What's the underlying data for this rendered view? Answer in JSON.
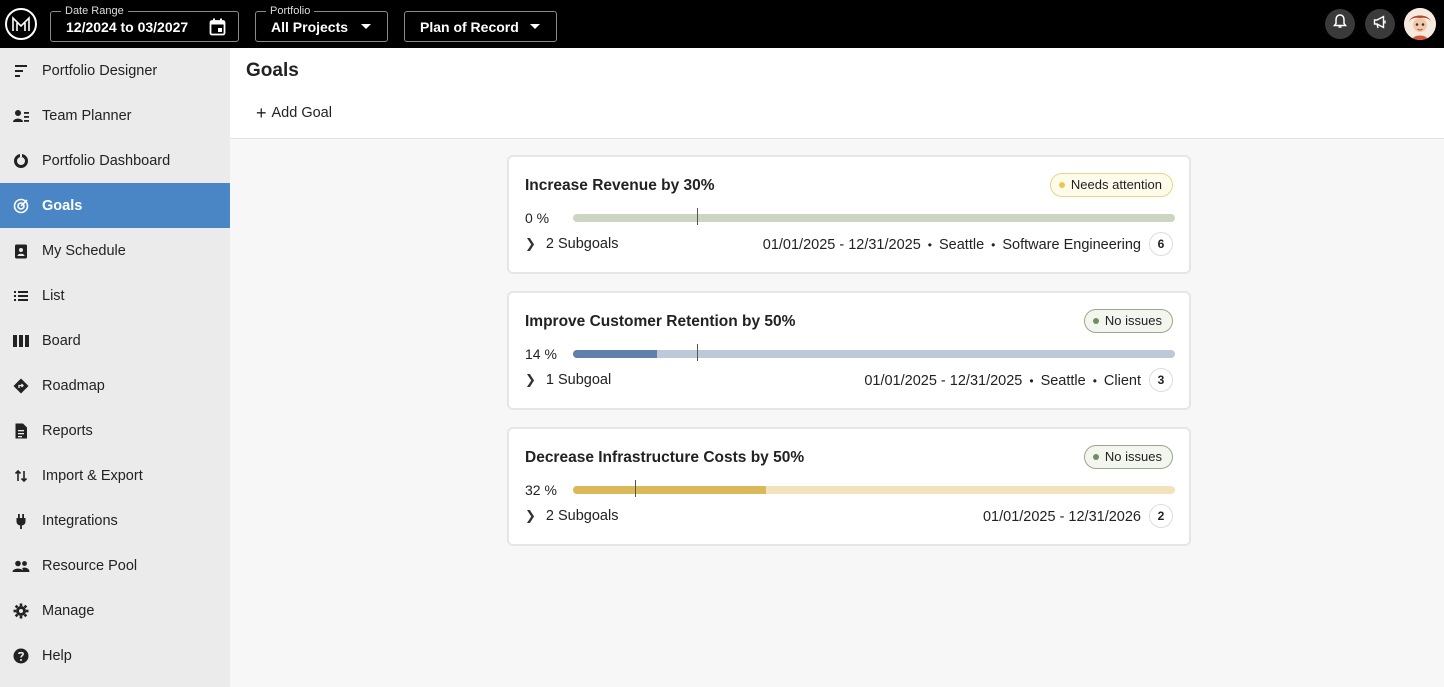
{
  "topbar": {
    "date_range": {
      "legend": "Date Range",
      "value": "12/2024 to 03/2027"
    },
    "portfolio": {
      "legend": "Portfolio",
      "value": "All Projects"
    },
    "plan": {
      "value": "Plan of Record"
    }
  },
  "sidebar": {
    "items": [
      {
        "label": "Portfolio Designer",
        "icon": "portfolio-designer-icon"
      },
      {
        "label": "Team Planner",
        "icon": "team-planner-icon"
      },
      {
        "label": "Portfolio Dashboard",
        "icon": "dashboard-icon"
      },
      {
        "label": "Goals",
        "icon": "goals-icon",
        "active": true
      },
      {
        "label": "My Schedule",
        "icon": "schedule-icon"
      },
      {
        "label": "List",
        "icon": "list-icon"
      },
      {
        "label": "Board",
        "icon": "board-icon"
      },
      {
        "label": "Roadmap",
        "icon": "roadmap-icon"
      },
      {
        "label": "Reports",
        "icon": "reports-icon"
      },
      {
        "label": "Import & Export",
        "icon": "import-export-icon"
      },
      {
        "label": "Integrations",
        "icon": "plug-icon"
      },
      {
        "label": "Resource Pool",
        "icon": "people-icon"
      },
      {
        "label": "Manage",
        "icon": "gear-icon"
      },
      {
        "label": "Help",
        "icon": "help-icon"
      }
    ]
  },
  "main": {
    "title": "Goals",
    "add_goal_label": "Add Goal",
    "goals": [
      {
        "title": "Increase Revenue by 30%",
        "status": "Needs attention",
        "progress_label": "0 %",
        "progress": 0,
        "subgoals": "2 Subgoals",
        "dates": "01/01/2025 - 12/31/2025",
        "location": "Seattle",
        "team": "Software Engineering",
        "count": "6",
        "colors": {
          "track": "#ccd5c2",
          "fill": "#a8b89a"
        }
      },
      {
        "title": "Improve Customer Retention by 50%",
        "status": "No issues",
        "progress_label": "14 %",
        "progress": 14,
        "subgoals": "1 Subgoal",
        "dates": "01/01/2025 - 12/31/2025",
        "location": "Seattle",
        "team": "Client",
        "count": "3",
        "colors": {
          "track": "#bcc9d9",
          "fill": "#5e80aa"
        }
      },
      {
        "title": "Decrease Infrastructure Costs by 50%",
        "status": "No issues",
        "progress_label": "32 %",
        "progress": 32,
        "subgoals": "2 Subgoals",
        "dates": "01/01/2025 - 12/31/2026",
        "count": "2",
        "colors": {
          "track": "#f0e3bd",
          "fill": "#d9b95a"
        }
      }
    ]
  }
}
